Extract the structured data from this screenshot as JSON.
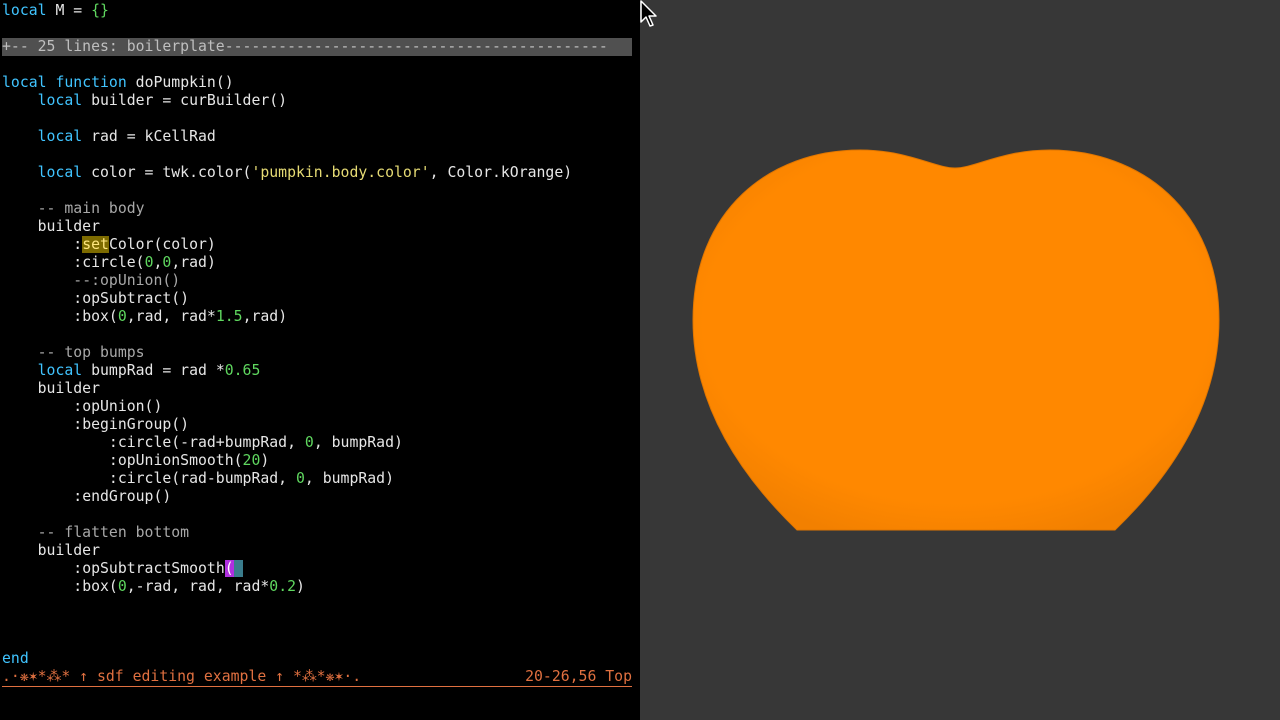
{
  "editor": {
    "lines": {
      "l1_kw": "local",
      "l1_rest": " M = ",
      "l1_braces": "{}",
      "fold": "+-- 25 lines: boilerplate-------------------------------------------",
      "fn_kw1": "local",
      "fn_kw2": "function",
      "fn_name": " doPumpkin()",
      "b_kw": "local",
      "b_rest": " builder = curBuilder()",
      "rad_kw": "local",
      "rad_rest": " rad = kCellRad",
      "color_kw": "local",
      "color_rest1": " color = twk.color(",
      "color_str": "'pumpkin.body.color'",
      "color_rest2": ", Color.kOrange)",
      "cmt_main": "-- main body",
      "builder1": "builder",
      "set_pre": ":",
      "set_hl": "set",
      "set_rest": "Color(color)",
      "circle_pre": ":circle(",
      "circle_n1": "0",
      "circle_c1": ",",
      "circle_n2": "0",
      "circle_rest": ",rad)",
      "opunion_cmt": "--:opUnion()",
      "opsub": ":opSubtract()",
      "box_pre": ":box(",
      "box_n1": "0",
      "box_mid": ",rad, rad*",
      "box_n2": "1.5",
      "box_rest": ",rad)",
      "cmt_bumps": "-- top bumps",
      "bump_kw": "local",
      "bump_rest": " bumpRad = rad *",
      "bump_num": "0.65",
      "builder2": "builder",
      "opunion": ":opUnion()",
      "begin": ":beginGroup()",
      "c1_pre": ":circle(-rad+bumpRad, ",
      "c1_num": "0",
      "c1_rest": ", bumpRad)",
      "smooth_pre": ":opUnionSmooth(",
      "smooth_num": "20",
      "smooth_rest": ")",
      "c2_pre": ":circle(rad-bumpRad, ",
      "c2_num": "0",
      "c2_rest": ", bumpRad)",
      "endgroup": ":endGroup()",
      "cmt_flat": "-- flatten bottom",
      "builder3": "builder",
      "subsmooth_pre": ":opSubtractSmooth",
      "subsmooth_paren": "(",
      "subsmooth_cursor": " ",
      "box2_pre": ":box(",
      "box2_n1": "0",
      "box2_mid": ",-rad, rad, rad*",
      "box2_n2": "0.2",
      "box2_rest": ")",
      "end_kw": "end"
    },
    "status": {
      "left": ".·❋✶*⁂* ↑ sdf editing example ↑ *⁂*❋✶·.",
      "right": "20-26,56 Top"
    }
  },
  "viewport": {
    "shape_color": "#ff8800",
    "background": "#373737",
    "cursor_icon": "mouse-pointer-icon"
  }
}
